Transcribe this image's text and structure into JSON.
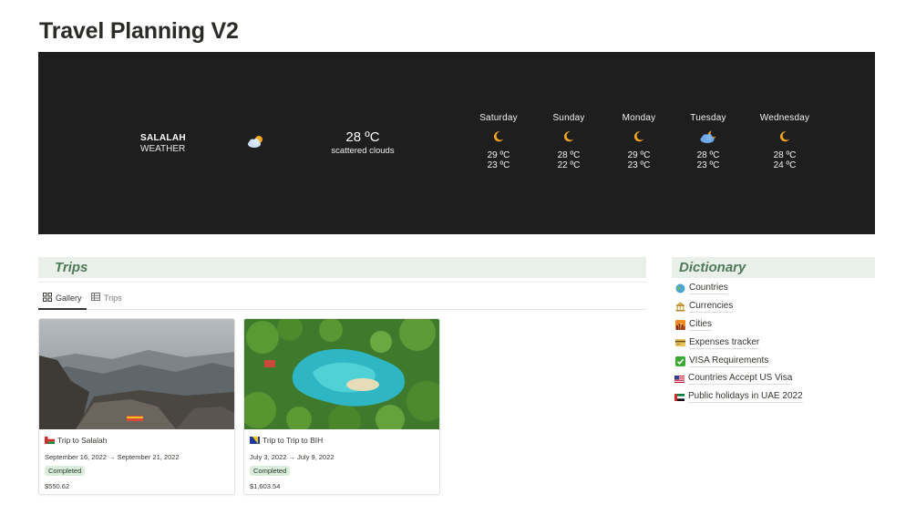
{
  "page": {
    "title": "Travel Planning V2"
  },
  "weather": {
    "city": "SALALAH",
    "subtitle": "WEATHER",
    "current_icon": "partly-cloudy-icon",
    "current_temp": "28 ºC",
    "current_desc": "scattered clouds",
    "forecast": [
      {
        "day": "Saturday",
        "icon": "moon-icon",
        "high": "29 ºC",
        "low": "23 ºC"
      },
      {
        "day": "Sunday",
        "icon": "moon-icon",
        "high": "28 ºC",
        "low": "22 ºC"
      },
      {
        "day": "Monday",
        "icon": "moon-icon",
        "high": "29 ºC",
        "low": "23 ºC"
      },
      {
        "day": "Tuesday",
        "icon": "cloud-moon-icon",
        "high": "28 ºC",
        "low": "23 ºC"
      },
      {
        "day": "Wednesday",
        "icon": "moon-icon",
        "high": "28 ºC",
        "low": "24 ºC"
      }
    ]
  },
  "trips": {
    "heading": "Trips",
    "tabs": [
      {
        "label": "Gallery",
        "icon": "gallery-icon"
      },
      {
        "label": "Trips",
        "icon": "table-icon"
      }
    ],
    "cards": [
      {
        "title": "Trip to Salalah",
        "flag": "oman-flag",
        "dates": "September 16, 2022 → September 21, 2022",
        "status": "Completed",
        "price": "$550.62"
      },
      {
        "title": "Trip to Trip to BIH",
        "flag": "bosnia-flag",
        "dates": "July 3, 2022 → July 9, 2022",
        "status": "Completed",
        "price": "$1,603.54"
      }
    ]
  },
  "dictionary": {
    "heading": "Dictionary",
    "items": [
      {
        "label": "Countries",
        "icon": "globe-icon"
      },
      {
        "label": "Currencies",
        "icon": "bank-icon"
      },
      {
        "label": "Cities",
        "icon": "city-sunset-icon"
      },
      {
        "label": "Expenses tracker",
        "icon": "credit-card-icon"
      },
      {
        "label": "VISA Requirements",
        "icon": "check-mark-icon"
      },
      {
        "label": "Countries Accept US Visa",
        "icon": "us-flag"
      },
      {
        "label": "Public holidays in UAE 2022",
        "icon": "uae-flag"
      }
    ]
  },
  "colors": {
    "widget_bg": "#1e1e1e",
    "section_bg": "#e9efe9",
    "section_text": "#4e7a58",
    "badge_bg": "#dbeddb",
    "moon": "#f5a623"
  }
}
